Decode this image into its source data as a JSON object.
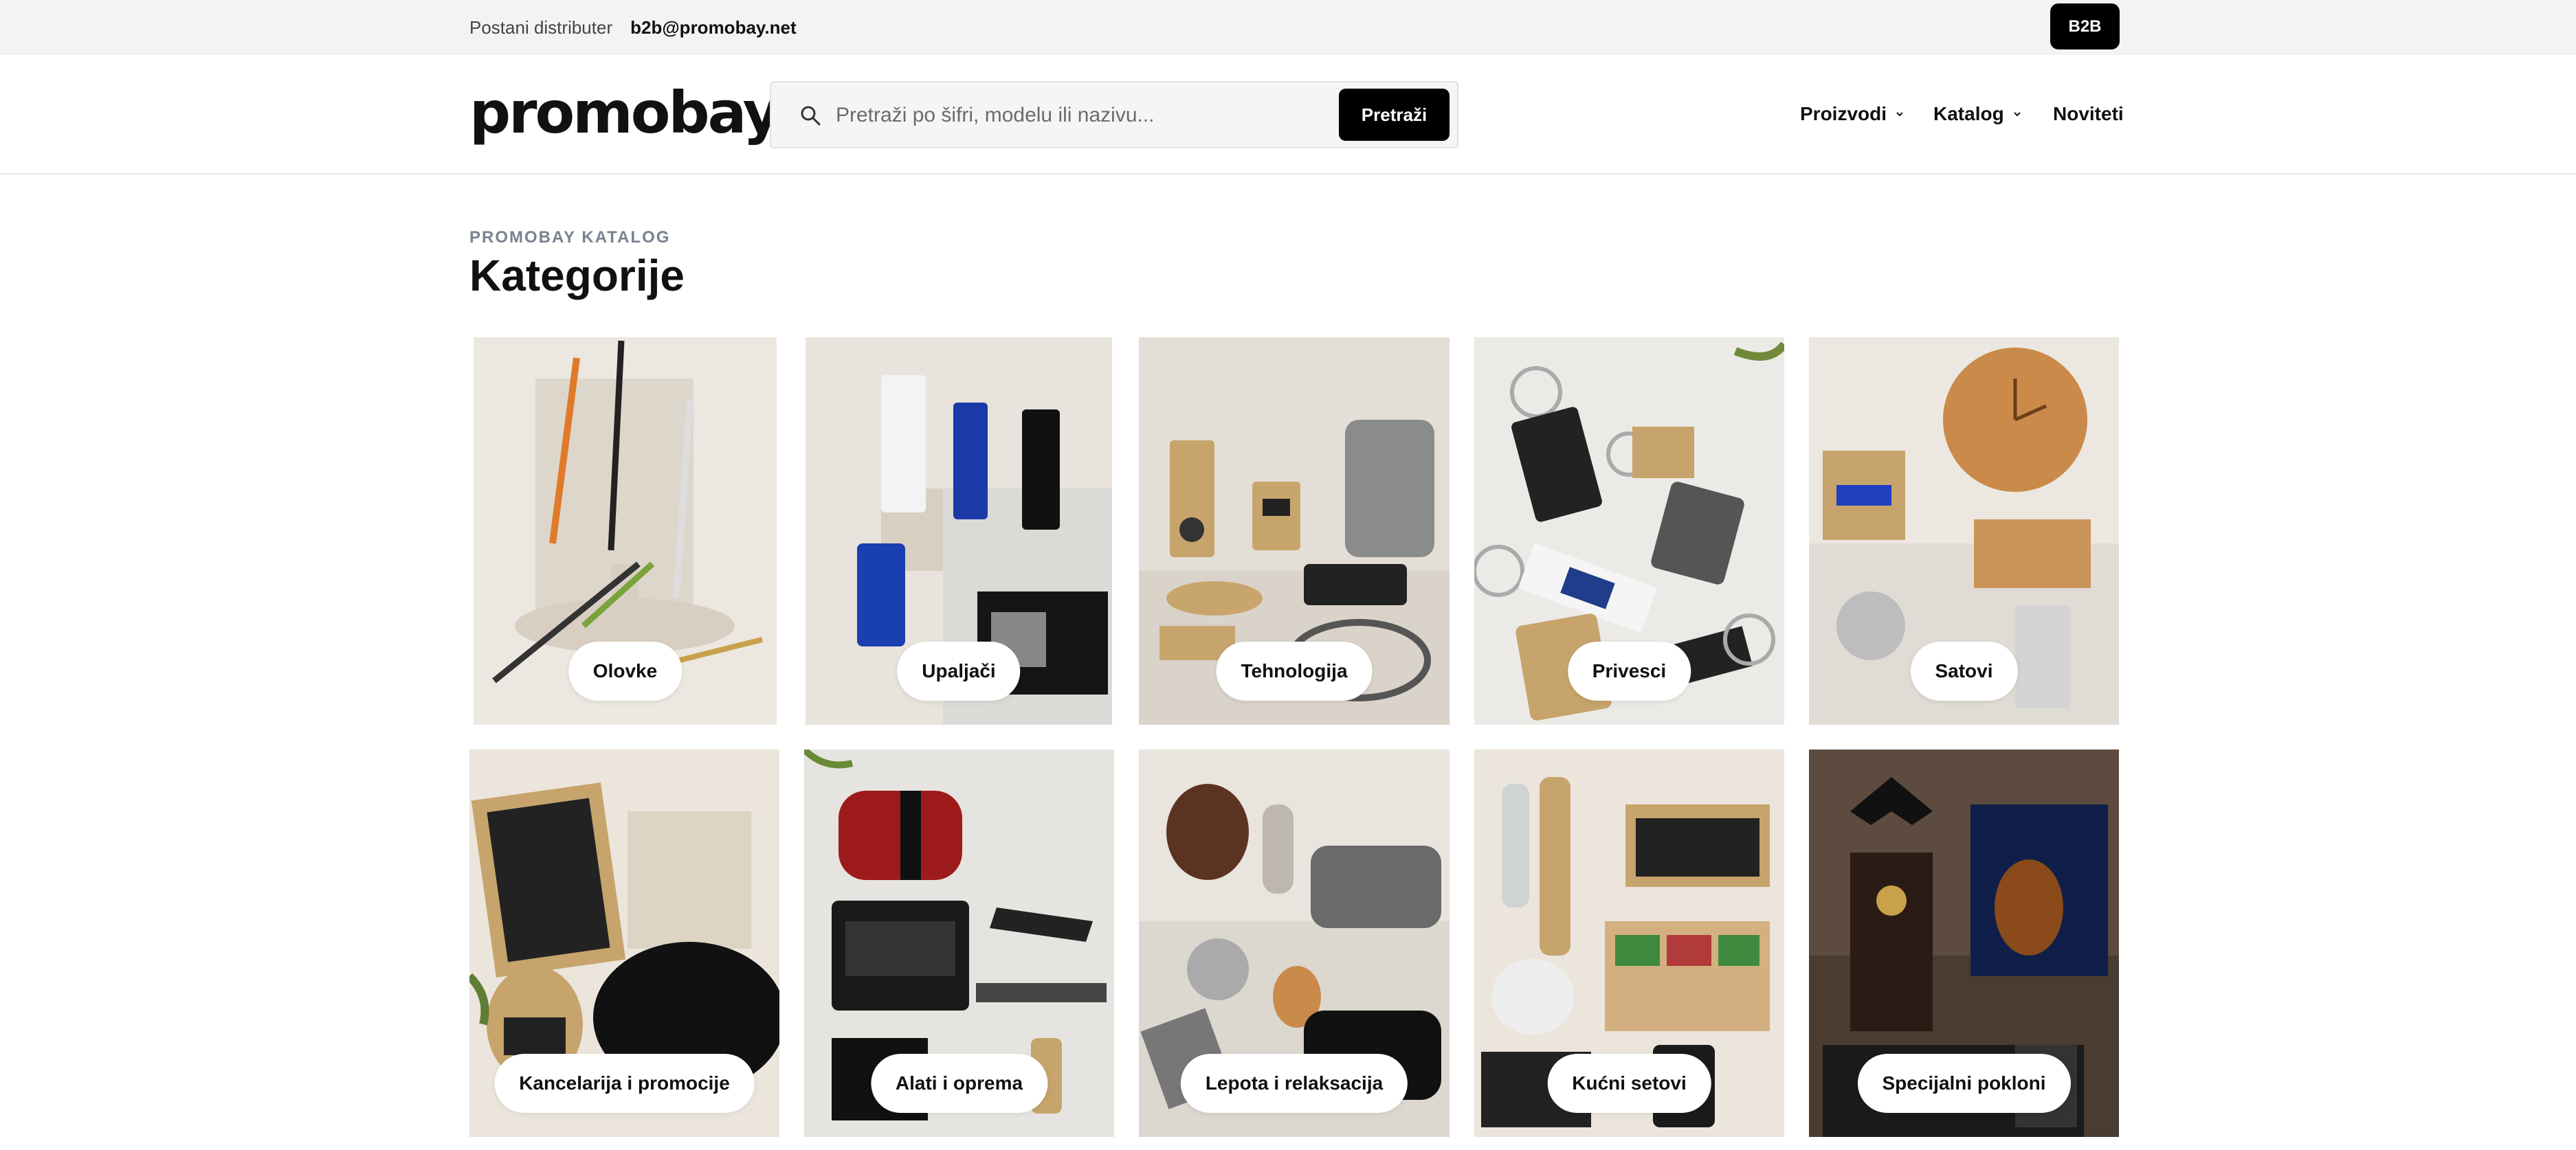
{
  "topbar": {
    "distributor_label": "Postani distributer",
    "email": "b2b@promobay.net",
    "b2b_button": "B2B"
  },
  "header": {
    "logo": "promobay",
    "search": {
      "placeholder": "Pretraži po šifri, modelu ili nazivu...",
      "button": "Pretraži"
    },
    "nav": [
      {
        "label": "Proizvodi"
      },
      {
        "label": "Katalog"
      },
      {
        "label": "Noviteti"
      }
    ]
  },
  "section": {
    "eyebrow": "PROMOBAY KATALOG",
    "title": "Kategorije"
  },
  "categories": [
    {
      "label": "Olovke"
    },
    {
      "label": "Upaljači"
    },
    {
      "label": "Tehnologija"
    },
    {
      "label": "Privesci"
    },
    {
      "label": "Satovi"
    },
    {
      "label": "Kancelarija i promocije"
    },
    {
      "label": "Alati i oprema"
    },
    {
      "label": "Lepota i relaksacija"
    },
    {
      "label": "Kućni setovi"
    },
    {
      "label": "Specijalni pokloni"
    }
  ],
  "colors": {
    "accent": "#000000",
    "topbar_bg": "#f3f3f3",
    "eyebrow": "#7a8190"
  },
  "icons": [
    "search-icon",
    "chevron-down-icon"
  ]
}
